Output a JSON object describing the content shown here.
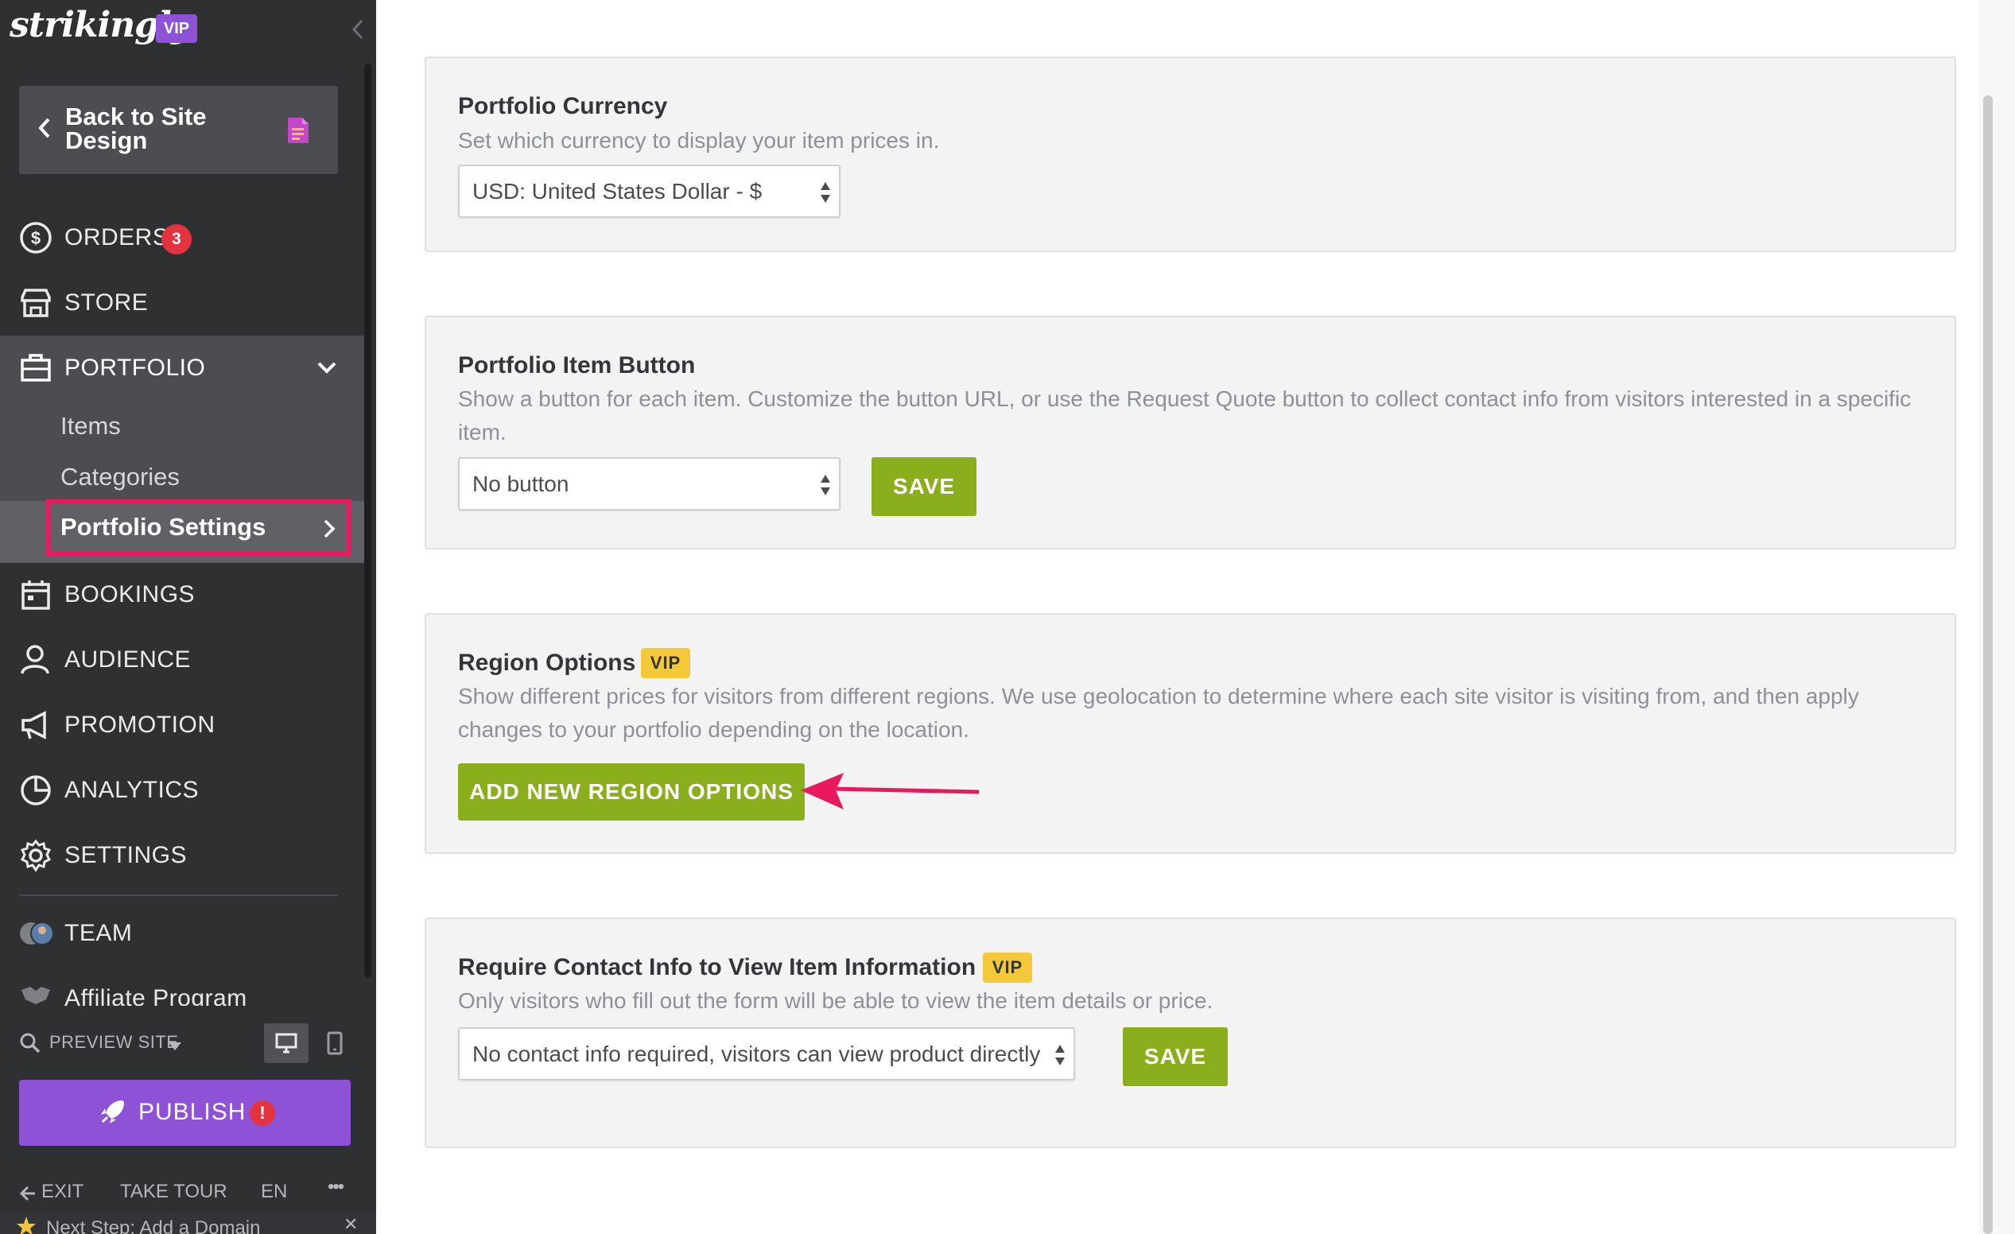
{
  "sidebar": {
    "logo": "strikingly",
    "logo_badge": "VIP",
    "back_label": "Back to Site Design",
    "nav": {
      "orders": "ORDERS",
      "orders_badge": "3",
      "store": "STORE",
      "portfolio": "PORTFOLIO",
      "portfolio_sub": {
        "items": "Items",
        "categories": "Categories",
        "settings": "Portfolio Settings"
      },
      "bookings": "BOOKINGS",
      "audience": "AUDIENCE",
      "promotion": "PROMOTION",
      "analytics": "ANALYTICS",
      "settings": "SETTINGS",
      "team": "TEAM",
      "affiliate": "Affiliate Program"
    },
    "preview_label": "PREVIEW SITE",
    "publish_label": "PUBLISH",
    "publish_alert": "!",
    "bottom": {
      "exit": "EXIT",
      "tour": "TAKE TOUR",
      "lang": "EN",
      "more": "•••"
    },
    "next_step": "Next Step: Add a Domain"
  },
  "main": {
    "currency": {
      "title": "Portfolio Currency",
      "desc": "Set which currency to display your item prices in.",
      "select_value": "USD: United States Dollar - $"
    },
    "item_button": {
      "title": "Portfolio Item Button",
      "desc": "Show a button for each item. Customize the button URL, or use the Request Quote button to collect contact info from visitors interested in a specific item.",
      "select_value": "No button",
      "save": "SAVE"
    },
    "region": {
      "title": "Region Options",
      "vip": "VIP",
      "desc": "Show different prices for visitors from different regions. We use geolocation to determine where each site visitor is visiting from, and then apply changes to your portfolio depending on the location.",
      "button": "ADD NEW REGION OPTIONS"
    },
    "contact": {
      "title": "Require Contact Info to View Item Information",
      "vip": "VIP",
      "desc": "Only visitors who fill out the form will be able to view the item details or price.",
      "select_value": "No contact info required, visitors can view product directly",
      "save": "SAVE"
    }
  },
  "colors": {
    "sidebar_bg": "#2f3031",
    "accent_purple": "#8e52d6",
    "green_button": "#8bae1d",
    "highlight_pink": "#e8195e",
    "vip_yellow": "#f3c93a"
  }
}
